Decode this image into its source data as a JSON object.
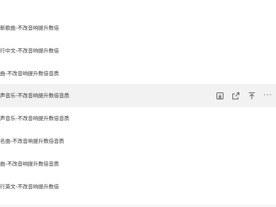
{
  "playlists": [
    {
      "title": "新歌曲-不改音响提升数倍"
    },
    {
      "title": "行中文-不改音响提升数倍"
    },
    {
      "title": "曲-不改音响提升数倍音质"
    },
    {
      "title": "声音乐-不改音响提升数倍音质"
    },
    {
      "title": "声音乐-不改音响提升数倍音质"
    },
    {
      "title": "名曲-不改音响提升数倍音质"
    },
    {
      "title": "曲-不改音响提升数倍音质"
    },
    {
      "title": "行英文-不改音响提升数倍"
    }
  ],
  "active_row_actions": {
    "icons": [
      "download-icon",
      "share-icon",
      "pin-to-top-icon",
      "more-icon"
    ],
    "more_glyph": "···"
  },
  "colors": {
    "text": "#333333",
    "active_row_bg": "#f2f2f2",
    "icon": "#555555"
  }
}
